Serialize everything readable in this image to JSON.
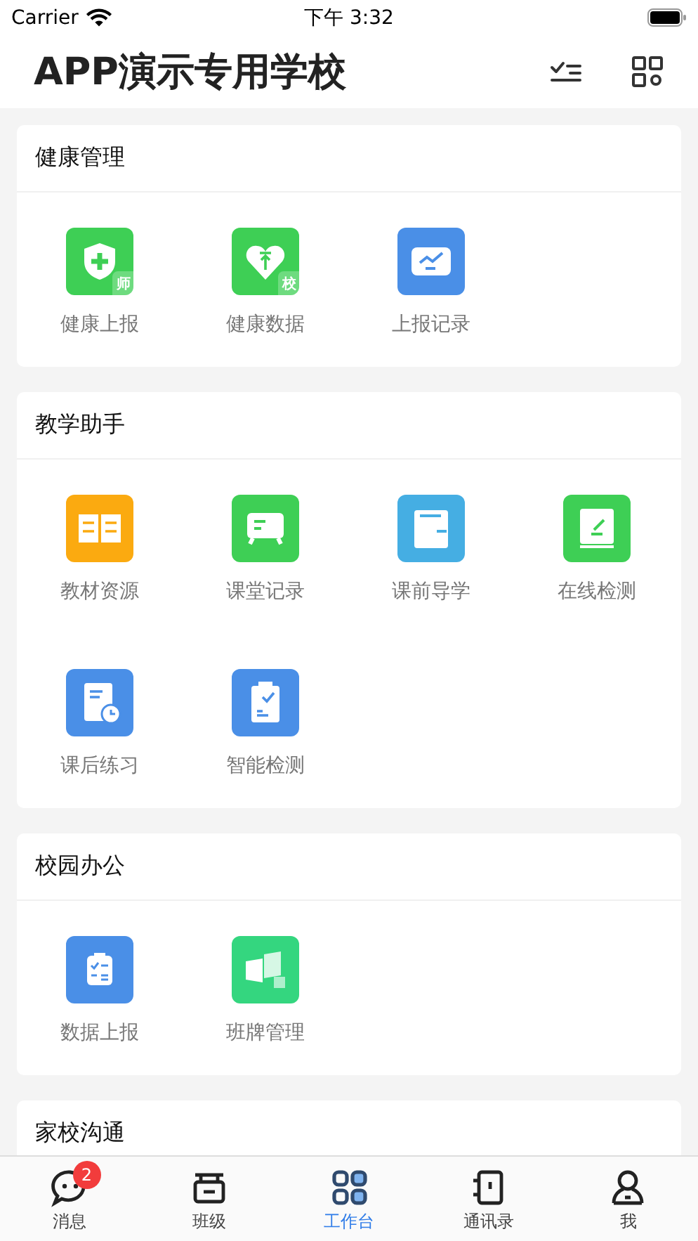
{
  "status_bar": {
    "carrier": "Carrier",
    "time": "下午 3:32"
  },
  "header": {
    "title": "APP演示专用学校"
  },
  "sections": [
    {
      "title": "健康管理",
      "items": [
        {
          "label": "健康上报",
          "kind": "shield",
          "color": "#3ecf55",
          "corner": "师"
        },
        {
          "label": "健康数据",
          "kind": "heart",
          "color": "#3ecf55",
          "corner": "校"
        },
        {
          "label": "上报记录",
          "kind": "monitor",
          "color": "#4a8fe7"
        }
      ]
    },
    {
      "title": "教学助手",
      "items": [
        {
          "label": "教材资源",
          "kind": "book",
          "color": "#fbaa10"
        },
        {
          "label": "课堂记录",
          "kind": "board",
          "color": "#3ecf55"
        },
        {
          "label": "课前导学",
          "kind": "notebook",
          "color": "#45aee3"
        },
        {
          "label": "在线检测",
          "kind": "pencil",
          "color": "#3ecf55"
        },
        {
          "label": "课后练习",
          "kind": "clockdoc",
          "color": "#4a8fe7"
        },
        {
          "label": "智能检测",
          "kind": "clipcheck",
          "color": "#4a8fe7"
        }
      ]
    },
    {
      "title": "校园办公",
      "items": [
        {
          "label": "数据上报",
          "kind": "clipboard",
          "color": "#4a8fe7"
        },
        {
          "label": "班牌管理",
          "kind": "panels",
          "color": "#34d67f"
        }
      ]
    },
    {
      "title": "家校沟通"
    }
  ],
  "tabs": [
    {
      "label": "消息",
      "kind": "chat",
      "selected": false,
      "badge": "2"
    },
    {
      "label": "班级",
      "kind": "class",
      "selected": false
    },
    {
      "label": "工作台",
      "kind": "grid",
      "selected": true
    },
    {
      "label": "通讯录",
      "kind": "contacts",
      "selected": false
    },
    {
      "label": "我",
      "kind": "person",
      "selected": false
    }
  ]
}
